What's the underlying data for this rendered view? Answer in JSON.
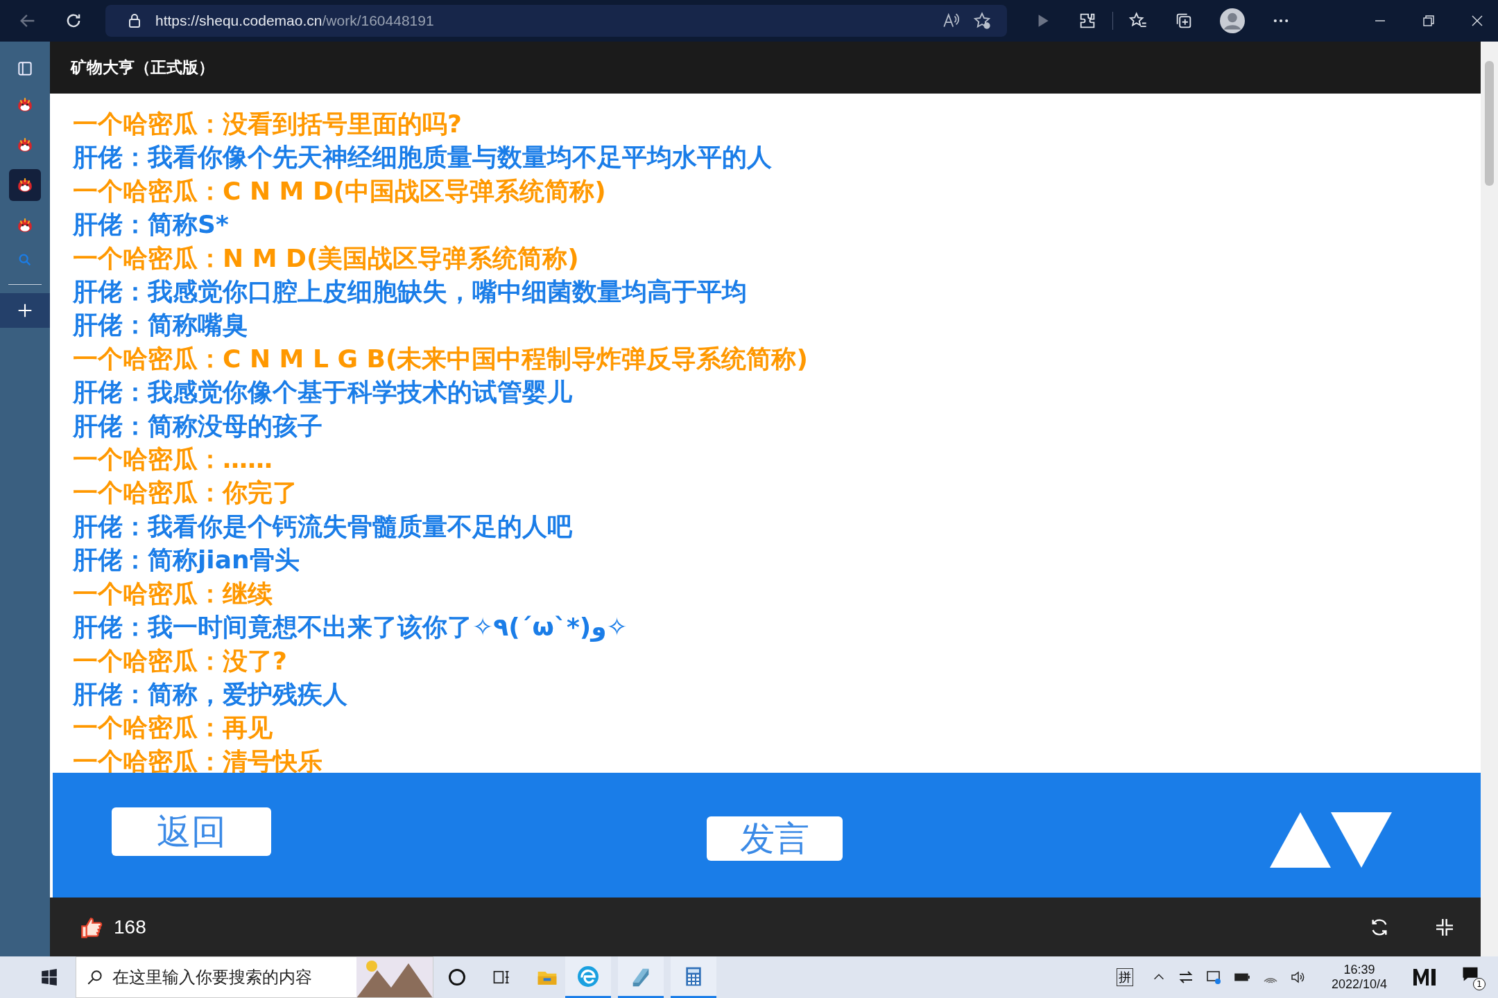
{
  "browser": {
    "url_host": "https://shequ.codemao.cn",
    "url_path": "/work/160448191"
  },
  "sidebar": {
    "tabs": [
      {
        "selected": false
      },
      {
        "selected": false
      },
      {
        "selected": true
      },
      {
        "selected": false
      }
    ]
  },
  "stage": {
    "title": "矿物大亨（正式版）",
    "messages": [
      {
        "text": "一个哈密瓜：没看到括号里面的吗?",
        "color": "#ff9800"
      },
      {
        "text": "肝佬：我看你像个先天神经细胞质量与数量均不足平均水平的人",
        "color": "#1a7de8"
      },
      {
        "text": "一个哈密瓜：C N M D(中国战区导弹系统简称)",
        "color": "#ff9800"
      },
      {
        "text": "肝佬：简称S*",
        "color": "#1a7de8"
      },
      {
        "text": "一个哈密瓜：N M D(美国战区导弹系统简称)",
        "color": "#ff9800"
      },
      {
        "text": "肝佬：我感觉你口腔上皮细胞缺失，嘴中细菌数量均高于平均",
        "color": "#1a7de8"
      },
      {
        "text": "肝佬：简称嘴臭",
        "color": "#1a7de8"
      },
      {
        "text": "一个哈密瓜：C N M L G B(未来中国中程制导炸弹反导系统简称)",
        "color": "#ff9800"
      },
      {
        "text": "肝佬：我感觉你像个基于科学技术的试管婴儿",
        "color": "#1a7de8"
      },
      {
        "text": "肝佬：简称没母的孩子",
        "color": "#1a7de8"
      },
      {
        "text": "一个哈密瓜：……",
        "color": "#ff9800"
      },
      {
        "text": "一个哈密瓜：你完了",
        "color": "#ff9800"
      },
      {
        "text": "肝佬：我看你是个钙流失骨髓质量不足的人吧",
        "color": "#1a7de8"
      },
      {
        "text": "肝佬：简称jian骨头",
        "color": "#1a7de8"
      },
      {
        "text": "一个哈密瓜：继续",
        "color": "#ff9800"
      },
      {
        "text": "肝佬：我一时间竟想不出来了该你了✧٩(ˊωˋ*)و✧",
        "color": "#1a7de8"
      },
      {
        "text": "一个哈密瓜：没了?",
        "color": "#ff9800"
      },
      {
        "text": "肝佬：简称，爱护残疾人",
        "color": "#1a7de8"
      },
      {
        "text": "一个哈密瓜：再见",
        "color": "#ff9800"
      },
      {
        "text": "一个哈密瓜：清号快乐",
        "color": "#ff9800"
      }
    ],
    "back_button": "返回",
    "speak_button": "发言",
    "likes": "168"
  },
  "taskbar": {
    "search_placeholder": "在这里输入你要搜索的内容",
    "ime": "拼",
    "time": "16:39",
    "date": "2022/10/4",
    "notifications": "1"
  }
}
